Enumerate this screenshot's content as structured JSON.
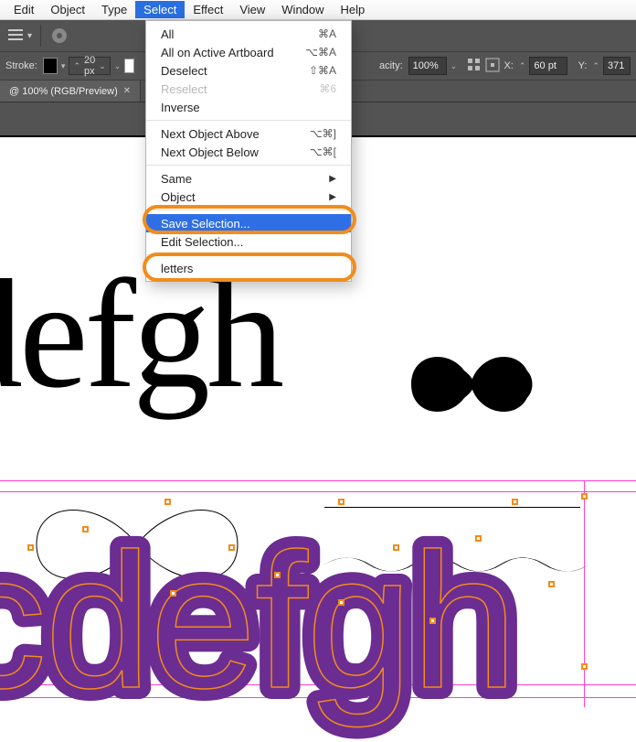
{
  "menubar": {
    "items": [
      "Edit",
      "Object",
      "Type",
      "Select",
      "Effect",
      "View",
      "Window",
      "Help"
    ],
    "active_index": 3
  },
  "dropdown": {
    "rows": [
      {
        "label": "All",
        "shortcut": "⌘A",
        "type": "item"
      },
      {
        "label": "All on Active Artboard",
        "shortcut": "⌥⌘A",
        "type": "item"
      },
      {
        "label": "Deselect",
        "shortcut": "⇧⌘A",
        "type": "item"
      },
      {
        "label": "Reselect",
        "shortcut": "⌘6",
        "type": "disabled"
      },
      {
        "label": "Inverse",
        "shortcut": "",
        "type": "item"
      },
      {
        "type": "sep"
      },
      {
        "label": "Next Object Above",
        "shortcut": "⌥⌘]",
        "type": "item"
      },
      {
        "label": "Next Object Below",
        "shortcut": "⌥⌘[",
        "type": "item"
      },
      {
        "type": "sep"
      },
      {
        "label": "Same",
        "type": "submenu"
      },
      {
        "label": "Object",
        "type": "submenu"
      },
      {
        "type": "sep"
      },
      {
        "label": "Save Selection...",
        "type": "highlight"
      },
      {
        "label": "Edit Selection...",
        "type": "item"
      },
      {
        "type": "sep"
      },
      {
        "label": "letters",
        "type": "item"
      }
    ]
  },
  "controlbar": {
    "stroke_label": "Stroke:",
    "stroke_value": "20 px",
    "opacity_label": "acity:",
    "opacity_value": "100%",
    "x_label": "X:",
    "x_value": "60 pt",
    "y_label": "Y:",
    "y_value": "371"
  },
  "doctab": {
    "title": "@ 100% (RGB/Preview)"
  },
  "art": {
    "black_text": "defgh",
    "purple_text": "cdefgh"
  }
}
